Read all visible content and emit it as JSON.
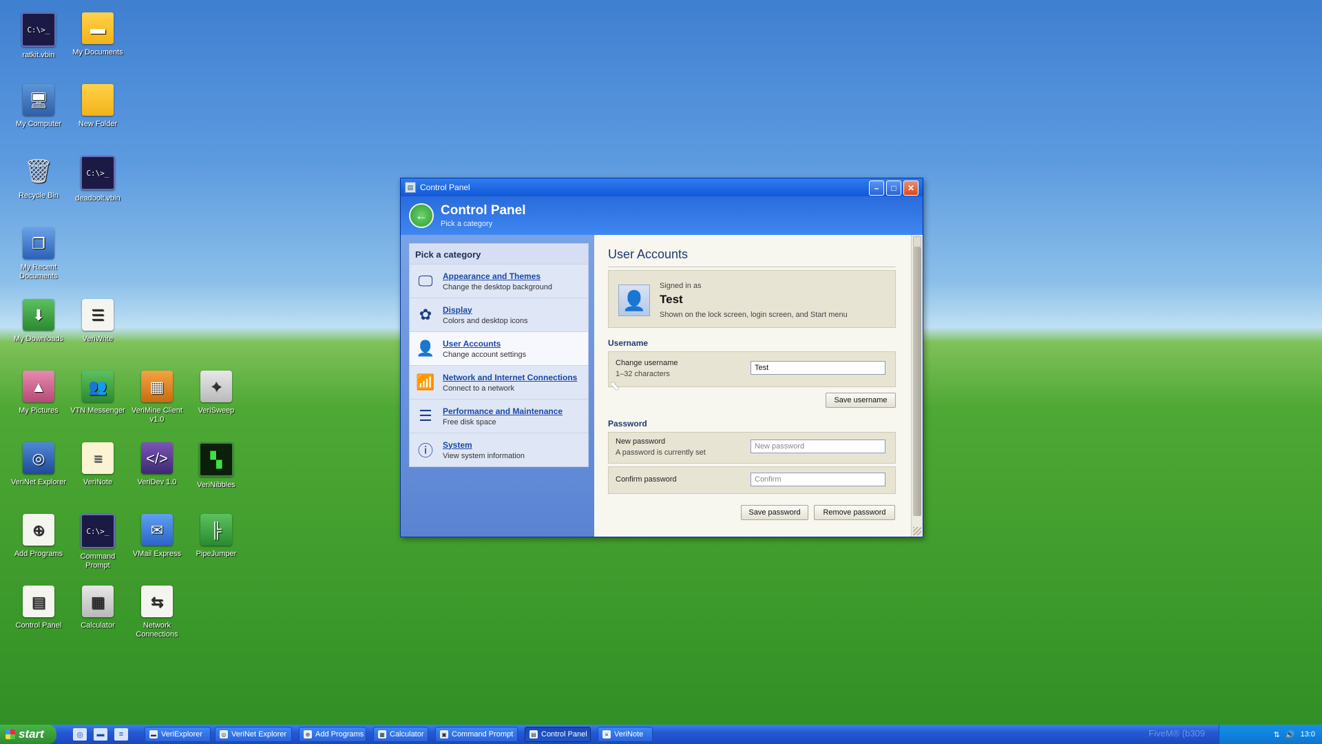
{
  "desktop": {
    "icons": [
      {
        "label": "ratkit.vbin",
        "glyph": "C:\\>_",
        "icon": "terminal-icon"
      },
      {
        "label": "My Documents",
        "glyph": "▬",
        "icon": "folder-icon"
      },
      {
        "label": "My Computer",
        "glyph": "🖥",
        "icon": "computer-icon"
      },
      {
        "label": "New Folder",
        "glyph": "",
        "icon": "folder-icon"
      },
      {
        "label": "Recycle Bin",
        "glyph": "🗑",
        "icon": "recycle-bin-icon"
      },
      {
        "label": "deadbolt.vbin",
        "glyph": "C:\\>_",
        "icon": "terminal-icon"
      },
      {
        "label": "My Recent Documents",
        "glyph": "❐",
        "icon": "recent-documents-icon"
      },
      {
        "label": "My Downloads",
        "glyph": "⬇",
        "icon": "downloads-icon"
      },
      {
        "label": "VeriWrite",
        "glyph": "☰",
        "icon": "document-icon"
      },
      {
        "label": "My Pictures",
        "glyph": "▲",
        "icon": "pictures-icon"
      },
      {
        "label": "VTN Messenger",
        "glyph": "👥",
        "icon": "messenger-icon"
      },
      {
        "label": "VeriMine Client v1.0",
        "glyph": "▦",
        "icon": "minesweeper-icon"
      },
      {
        "label": "VeriSweep",
        "glyph": "✦",
        "icon": "sweep-icon"
      },
      {
        "label": "VeriNet Explorer",
        "glyph": "◎",
        "icon": "browser-icon"
      },
      {
        "label": "VeriNote",
        "glyph": "≡",
        "icon": "note-icon"
      },
      {
        "label": "VeriDev 1.0",
        "glyph": "</>",
        "icon": "code-icon"
      },
      {
        "label": "VeriNibbles",
        "glyph": "▚",
        "icon": "snake-game-icon"
      },
      {
        "label": "Add Programs",
        "glyph": "⊕",
        "icon": "add-programs-icon"
      },
      {
        "label": "Command Prompt",
        "glyph": "C:\\>_",
        "icon": "terminal-icon"
      },
      {
        "label": "VMail Express",
        "glyph": "✉",
        "icon": "mail-icon"
      },
      {
        "label": "PipeJumper",
        "glyph": "╠",
        "icon": "pipe-game-icon"
      },
      {
        "label": "Control Panel",
        "glyph": "▤",
        "icon": "control-panel-icon"
      },
      {
        "label": "Calculator",
        "glyph": "▦",
        "icon": "calculator-icon"
      },
      {
        "label": "Network Connections",
        "glyph": "⇆",
        "icon": "network-icon"
      }
    ]
  },
  "window": {
    "title": "Control Panel",
    "header_title": "Control Panel",
    "header_subtitle": "Pick a category",
    "categories_heading": "Pick a category",
    "categories": [
      {
        "title": "Appearance and Themes",
        "desc": "Change the desktop background",
        "icon": "monitor-icon",
        "glyph": "🖵"
      },
      {
        "title": "Display",
        "desc": "Colors and desktop icons",
        "icon": "palette-icon",
        "glyph": "✿"
      },
      {
        "title": "User Accounts",
        "desc": "Change account settings",
        "icon": "user-icon",
        "glyph": "👤"
      },
      {
        "title": "Network and Internet Connections",
        "desc": "Connect to a network",
        "icon": "wifi-icon",
        "glyph": "📶"
      },
      {
        "title": "Performance and Maintenance",
        "desc": "Free disk space",
        "icon": "storage-icon",
        "glyph": "☰"
      },
      {
        "title": "System",
        "desc": "View system information",
        "icon": "info-icon",
        "glyph": "ⓘ"
      }
    ],
    "user_accounts": {
      "title": "User Accounts",
      "signed_in_label": "Signed in as",
      "username": "Test",
      "signed_desc": "Shown on the lock screen, login screen, and Start menu",
      "username_section": "Username",
      "change_username_label": "Change username",
      "change_username_hint": "1–32 characters",
      "username_value": "Test",
      "save_username": "Save username",
      "password_section": "Password",
      "new_password_label": "New password",
      "new_password_hint": "A password is currently set",
      "new_password_placeholder": "New password",
      "confirm_password_label": "Confirm password",
      "confirm_placeholder": "Confirm",
      "save_password": "Save password",
      "remove_password": "Remove password"
    }
  },
  "taskbar": {
    "start_label": "start",
    "tasks": [
      "VeriExplorer",
      "VeriNet Explorer",
      "Add Programs",
      "Calculator",
      "Command Prompt",
      "Control Panel",
      "VeriNote"
    ],
    "active_task": "Control Panel",
    "clock": "13:0",
    "watermark": "FiveM® (b309"
  }
}
